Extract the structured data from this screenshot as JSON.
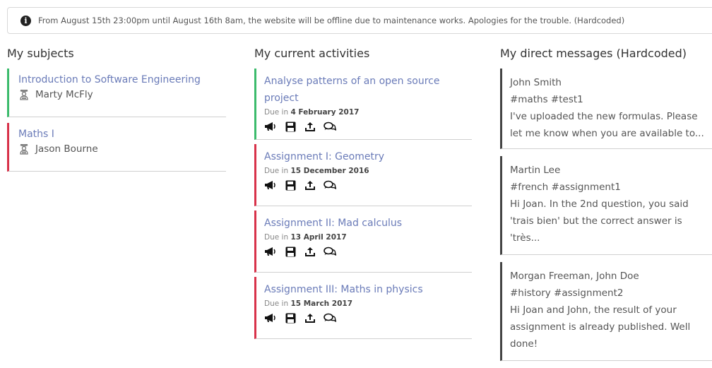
{
  "notice": {
    "icon": "info-icon",
    "text": "From August 15th 23:00pm until August 16th 8am, the website will be offline due to maintenance works. Apologies for the trouble. (Hardcoded)"
  },
  "subjects": {
    "title": "My subjects",
    "items": [
      {
        "name": "Introduction to Software Engineering",
        "teacher": "Marty McFly",
        "color": "#3cbb6c"
      },
      {
        "name": "Maths I",
        "teacher": "Jason Bourne",
        "color": "#d8324a"
      }
    ]
  },
  "activities": {
    "title": "My current activities",
    "due_prefix": "Due in",
    "items": [
      {
        "title": "Analyse patterns of an open source project",
        "due": "4 February 2017",
        "color": "#3cbb6c"
      },
      {
        "title": "Assignment I: Geometry",
        "due": "15 December 2016",
        "color": "#d8324a"
      },
      {
        "title": "Assignment II: Mad calculus",
        "due": "13 April 2017",
        "color": "#d8324a"
      },
      {
        "title": "Assignment III: Maths in physics",
        "due": "15 March 2017",
        "color": "#d8324a"
      }
    ],
    "icons": [
      "megaphone-icon",
      "save-icon",
      "upload-icon",
      "comments-icon"
    ]
  },
  "messages": {
    "title": "My direct messages (Hardcoded)",
    "items": [
      {
        "from": "John Smith",
        "tags": "#maths #test1",
        "body": "I've uploaded the new formulas. Please let me know when you are available to..."
      },
      {
        "from": "Martin Lee",
        "tags": "#french #assignment1",
        "body": "Hi Joan. In the 2nd question, you said 'trais bien' but the correct answer is 'très..."
      },
      {
        "from": "Morgan Freeman, John Doe",
        "tags": "#history #assignment2",
        "body": "Hi Joan and John, the result of your assignment is already published. Well done!"
      }
    ]
  }
}
